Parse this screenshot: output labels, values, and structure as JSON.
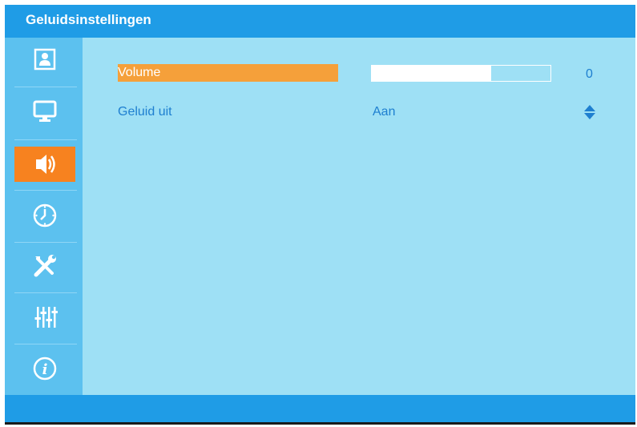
{
  "header": {
    "title": "Geluidsinstellingen"
  },
  "sidebar": {
    "items": [
      {
        "icon": "person-picture-icon",
        "active": false
      },
      {
        "icon": "monitor-icon",
        "active": false
      },
      {
        "icon": "speaker-icon",
        "active": true
      },
      {
        "icon": "clock-icon",
        "active": false
      },
      {
        "icon": "tools-icon",
        "active": false
      },
      {
        "icon": "equalizer-sliders-icon",
        "active": false
      },
      {
        "icon": "info-icon",
        "active": false
      }
    ]
  },
  "settings": {
    "volume": {
      "label": "Volume",
      "value": "0",
      "level_fraction": 0.67
    },
    "mute": {
      "label": "Geluid uit",
      "value": "Aan"
    }
  },
  "colors": {
    "header": "#1f9ce6",
    "sidebar": "#5cc1ef",
    "content": "#9ee0f5",
    "accent": "#f7821f",
    "text": "#1e7fd0"
  }
}
